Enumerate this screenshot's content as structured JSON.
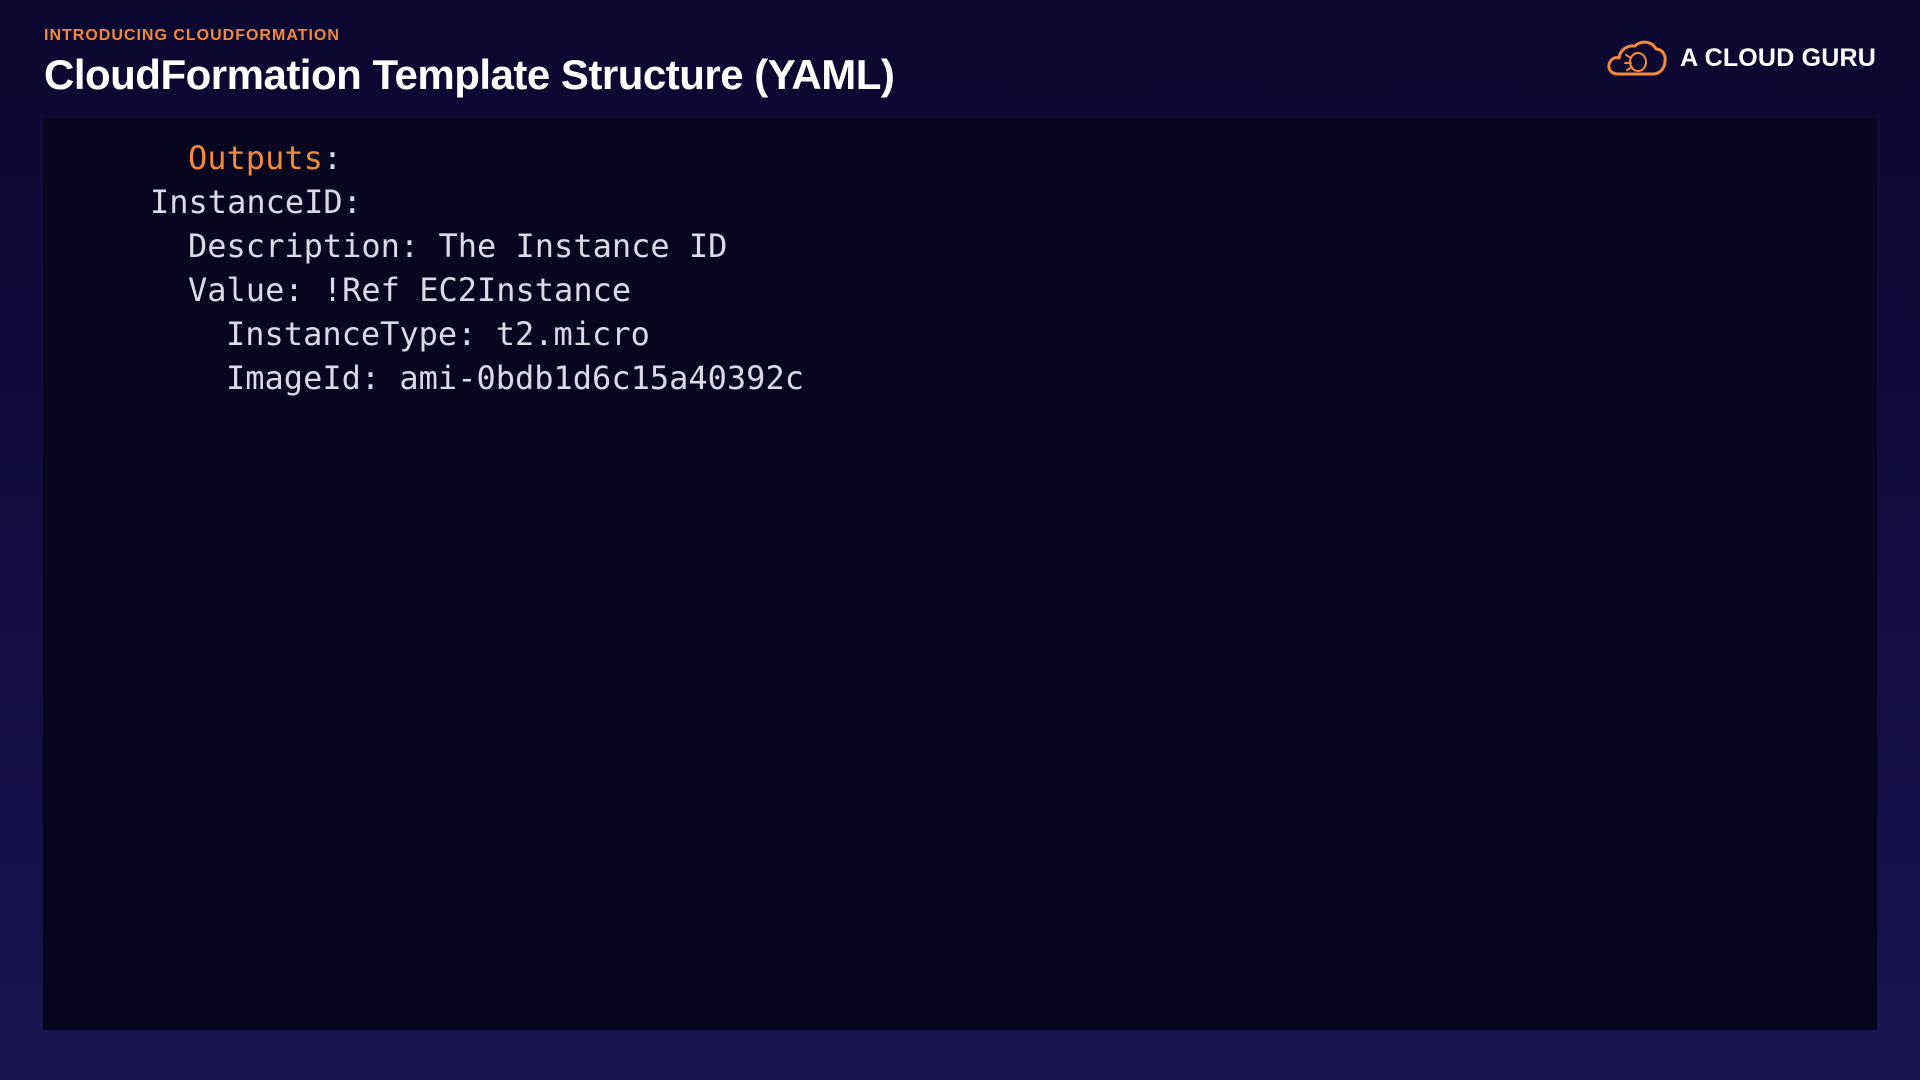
{
  "header": {
    "eyebrow": "INTRODUCING CLOUDFORMATION",
    "title": "CloudFormation Template Structure (YAML)"
  },
  "brand": {
    "name": "A CLOUD GURU",
    "logo_icon": "cloud-logo-icon",
    "accent_color": "#f28a3a"
  },
  "code": {
    "lines": [
      {
        "key": "Outputs",
        "sep": ":",
        "highlight": true
      },
      {
        "text": "InstanceID:"
      },
      {
        "text": "Description: The Instance ID"
      },
      {
        "text": "Value: !Ref EC2Instance"
      },
      {
        "text": "InstanceType: t2.micro"
      },
      {
        "text": "ImageId: ami-0bdb1d6c15a40392c"
      }
    ]
  }
}
